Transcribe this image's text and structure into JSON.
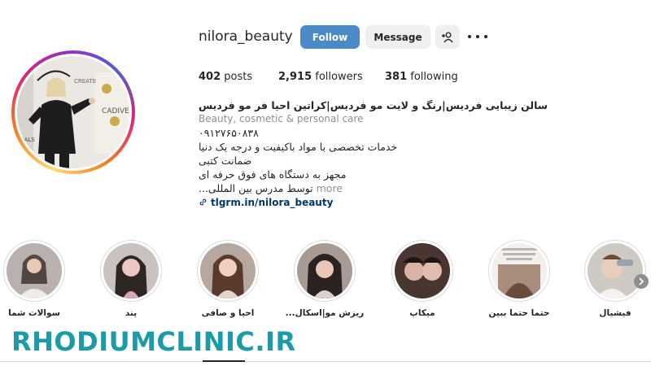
{
  "profile": {
    "username": "nilora_beauty",
    "follow_label": "Follow",
    "message_label": "Message",
    "add_user_icon": "add-user-icon",
    "more_icon": "more-options-icon"
  },
  "stats": {
    "posts_count": "402",
    "posts_label": "posts",
    "followers_count": "2,915",
    "followers_label": "followers",
    "following_count": "381",
    "following_label": "following"
  },
  "bio": {
    "name": "سالن زیبایی فردیس|رنگ و لایت مو فردیس|کراتین احیا فر مو فردیس",
    "category": "Beauty, cosmetic & personal care",
    "phone": "۰۹۱۲۷۶۵۰۸۳۸",
    "line1": "خدمات تخصصی با مواد باکیفیت و درجه یک دنیا",
    "line2": "ضمانت کتبی",
    "line3": "مجهز به دستگاه های فوق حرفه ای",
    "line4": "توسط مدرس بین المللی...",
    "more_label": "more",
    "link_text": "tlgrm.in/nilora_beauty",
    "link_icon": "link-icon"
  },
  "highlights": [
    {
      "label": "سوالات شما"
    },
    {
      "label": "پند"
    },
    {
      "label": "احیا و صافی"
    },
    {
      "label": "ریزش مو|اسکال..."
    },
    {
      "label": "میکاپ"
    },
    {
      "label": "حتما حتما ببین"
    },
    {
      "label": "فیشیال"
    }
  ],
  "watermark": "RHODIUMCLINIC.IR",
  "colors": {
    "follow_button": "#4a8ac6",
    "secondary_button": "#efefef",
    "link": "#00376b",
    "watermark": "#1b9aa8"
  }
}
